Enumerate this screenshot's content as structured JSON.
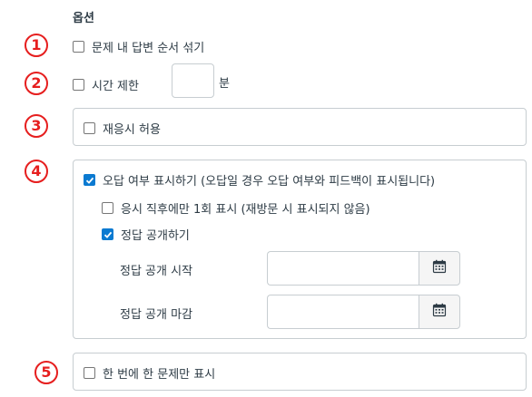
{
  "section_title": "옵션",
  "markers": [
    "1",
    "2",
    "3",
    "4",
    "5"
  ],
  "options": {
    "shuffle_answers": {
      "label": "문제 내 답변 순서 섞기",
      "checked": false
    },
    "time_limit": {
      "label": "시간 제한",
      "checked": false,
      "value": "",
      "unit": "분"
    },
    "allow_retake": {
      "label": "재응시 허용",
      "checked": false
    },
    "show_correctness": {
      "label": "오답 여부 표시하기 (오답일 경우 오답 여부와 피드백이 표시됩니다)",
      "checked": true
    },
    "show_once": {
      "label": "응시 직후에만 1회 표시 (재방문 시 표시되지 않음)",
      "checked": false
    },
    "show_answers": {
      "label": "정답 공개하기",
      "checked": true
    },
    "reveal_start": {
      "label": "정답 공개 시작",
      "value": ""
    },
    "reveal_end": {
      "label": "정답 공개 마감",
      "value": ""
    },
    "one_question": {
      "label": "한 번에 한 문제만 표시",
      "checked": false
    }
  },
  "colors": {
    "marker": "#e61e1e",
    "checkbox_checked": "#0b7ad1",
    "border": "#c7cdd1"
  },
  "icons": {
    "date_picker": "calendar-icon",
    "checkmark": "checkmark-icon"
  }
}
